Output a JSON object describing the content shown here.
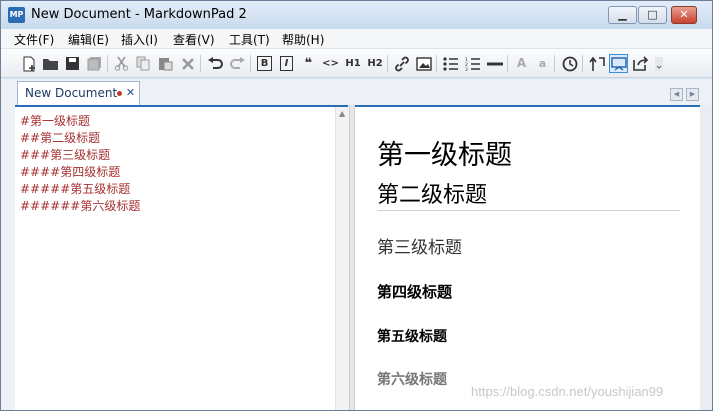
{
  "window": {
    "title": "New Document - MarkdownPad 2",
    "app_icon_text": "MP",
    "controls": {
      "minimize": "▁",
      "maximize": "□",
      "close": "✕"
    }
  },
  "menu": {
    "items": [
      {
        "label": "文件(F)"
      },
      {
        "label": "编辑(E)"
      },
      {
        "label": "插入(I)"
      },
      {
        "label": "查看(V)"
      },
      {
        "label": "工具(T)"
      },
      {
        "label": "帮助(H)"
      }
    ]
  },
  "toolbar": {
    "buttons": [
      {
        "name": "new-document-icon"
      },
      {
        "name": "open-folder-icon"
      },
      {
        "name": "save-icon"
      },
      {
        "name": "save-all-icon"
      },
      {
        "name": "cut-icon"
      },
      {
        "name": "copy-icon"
      },
      {
        "name": "paste-icon"
      },
      {
        "name": "delete-icon"
      },
      {
        "name": "undo-icon"
      },
      {
        "name": "redo-icon"
      },
      {
        "name": "bold-icon",
        "text": "B"
      },
      {
        "name": "italic-icon",
        "text": "I"
      },
      {
        "name": "quote-icon",
        "text": "❝"
      },
      {
        "name": "code-icon",
        "text": "<>"
      },
      {
        "name": "heading1-icon",
        "text": "H1"
      },
      {
        "name": "heading2-icon",
        "text": "H2"
      },
      {
        "name": "link-icon"
      },
      {
        "name": "image-icon"
      },
      {
        "name": "bullet-list-icon"
      },
      {
        "name": "numbered-list-icon"
      },
      {
        "name": "horizontal-rule-icon"
      },
      {
        "name": "uppercase-icon",
        "text": "A"
      },
      {
        "name": "lowercase-icon",
        "text": "a"
      },
      {
        "name": "timestamp-icon"
      },
      {
        "name": "sync-scroll-icon"
      },
      {
        "name": "live-preview-icon"
      },
      {
        "name": "export-icon"
      }
    ]
  },
  "tabs": [
    {
      "label": "New Document",
      "modified": true,
      "close": "✕"
    }
  ],
  "tab_nav": {
    "prev": "◀",
    "next": "▶"
  },
  "editor": {
    "lines": [
      "#第一级标题",
      "##第二级标题",
      "###第三级标题",
      "####第四级标题",
      "#####第五级标题",
      "######第六级标题"
    ],
    "scroll_arrow": "▲"
  },
  "preview": {
    "h1": "第一级标题",
    "h2": "第二级标题",
    "h3": "第三级标题",
    "h4": "第四级标题",
    "h5": "第五级标题",
    "h6": "第六级标题"
  },
  "watermark": "https://blog.csdn.net/youshijian99"
}
